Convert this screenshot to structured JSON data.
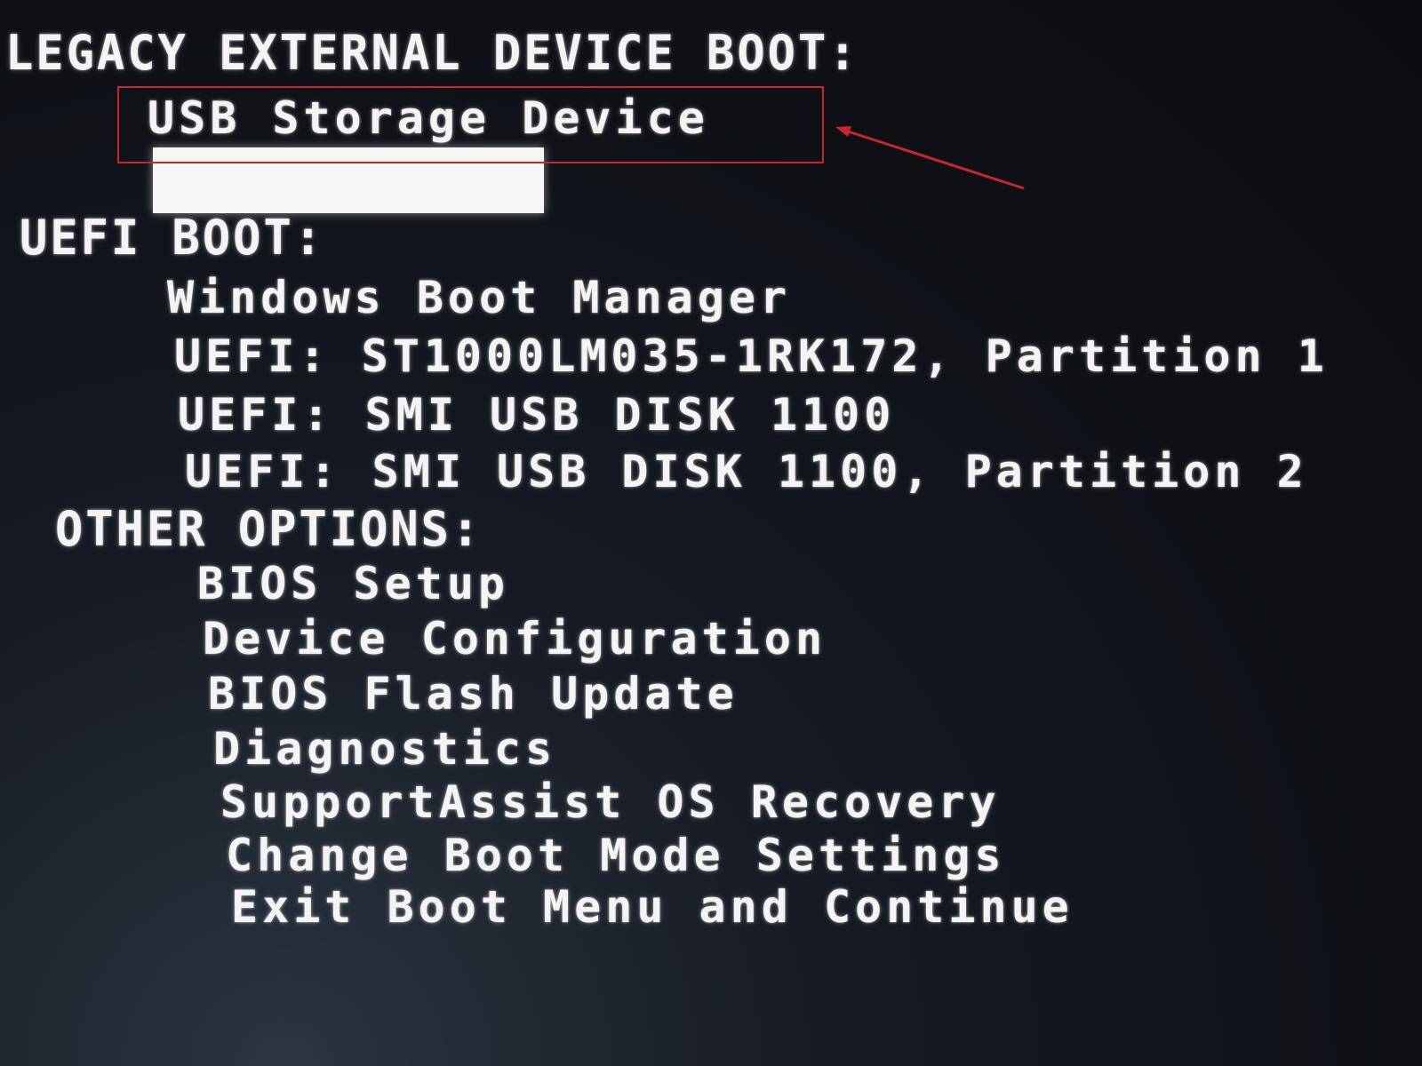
{
  "legacy": {
    "heading": "LEGACY EXTERNAL DEVICE BOOT:",
    "items": [
      "USB Storage Device"
    ]
  },
  "uefi": {
    "heading": "UEFI BOOT:",
    "items": [
      "Windows Boot Manager",
      "UEFI: ST1000LM035-1RK172, Partition 1",
      "UEFI: SMI USB DISK 1100",
      "UEFI: SMI USB DISK 1100, Partition 2"
    ]
  },
  "other": {
    "heading": "OTHER OPTIONS:",
    "items": [
      "BIOS Setup",
      "Device Configuration",
      "BIOS Flash Update",
      "Diagnostics",
      "SupportAssist OS Recovery",
      "Change Boot Mode Settings",
      "Exit Boot Menu and Continue"
    ]
  },
  "colors": {
    "text": "#f4f4f4",
    "background": "#101218",
    "annotation": "#c8262b",
    "highlight_bar": "#f6f6f6"
  }
}
